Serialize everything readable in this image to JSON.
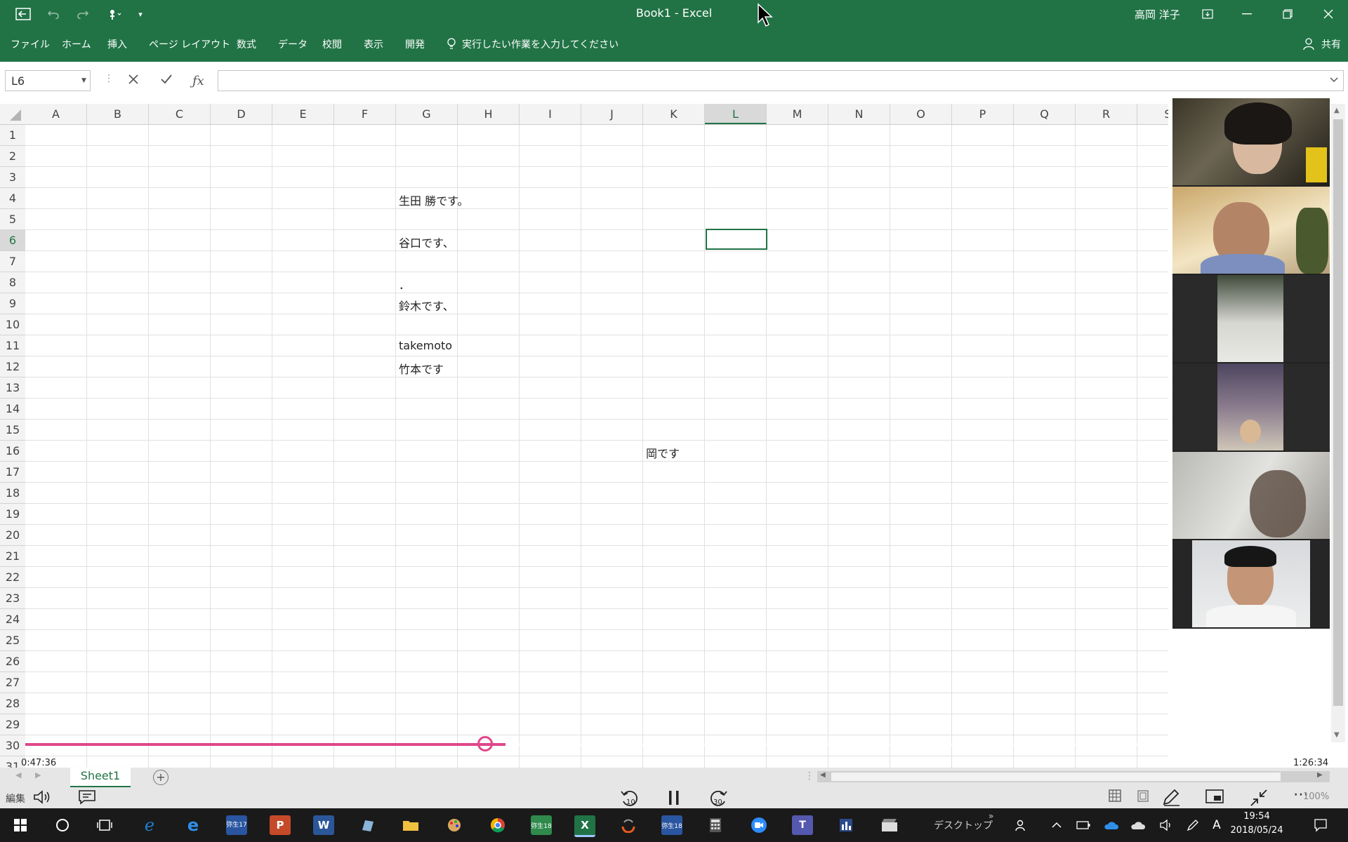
{
  "window": {
    "title": "Book1  -  Excel",
    "user": "高岡 洋子"
  },
  "ribbon": {
    "tabs": [
      "ファイル",
      "ホーム",
      "挿入",
      "ページ レイアウト",
      "数式",
      "データ",
      "校閲",
      "表示",
      "開発"
    ],
    "tell_me": "実行したい作業を入力してください",
    "share": "共有"
  },
  "formula_bar": {
    "name_box": "L6",
    "formula": ""
  },
  "grid": {
    "columns": [
      "A",
      "B",
      "C",
      "D",
      "E",
      "F",
      "G",
      "H",
      "I",
      "J",
      "K",
      "L",
      "M",
      "N",
      "O",
      "P",
      "Q",
      "R",
      "S"
    ],
    "rows": [
      "1",
      "2",
      "3",
      "4",
      "5",
      "6",
      "7",
      "8",
      "9",
      "10",
      "11",
      "12",
      "13",
      "14",
      "15",
      "16",
      "17",
      "18",
      "19",
      "20",
      "21",
      "22",
      "23",
      "24",
      "25",
      "26",
      "27",
      "28",
      "29",
      "30",
      "31"
    ],
    "selected_column": "L",
    "selected_row": "6",
    "cells": {
      "G4": "生田 勝です。",
      "G6": "谷口です、",
      "G8": "．",
      "G9": "鈴木です、",
      "G11": "takemoto",
      "G12": "竹本です",
      "K16": "岡です"
    }
  },
  "player": {
    "current_time": "0:47:36",
    "total_time": "1:26:34",
    "progress": 0.55,
    "rewind_label": "10",
    "forward_label": "30"
  },
  "sheets": {
    "tabs": [
      "Sheet1"
    ],
    "add_symbol": "+"
  },
  "status": {
    "mode": "編集",
    "zoom": "100%"
  },
  "taskbar": {
    "desktop": "デスクトップ",
    "time": "19:54",
    "date": "2018/05/24",
    "yayoi17": "弥生17",
    "yayoi18": "弥生18"
  },
  "colors": {
    "excel_green": "#217346",
    "playback_pink": "#e0478a"
  }
}
